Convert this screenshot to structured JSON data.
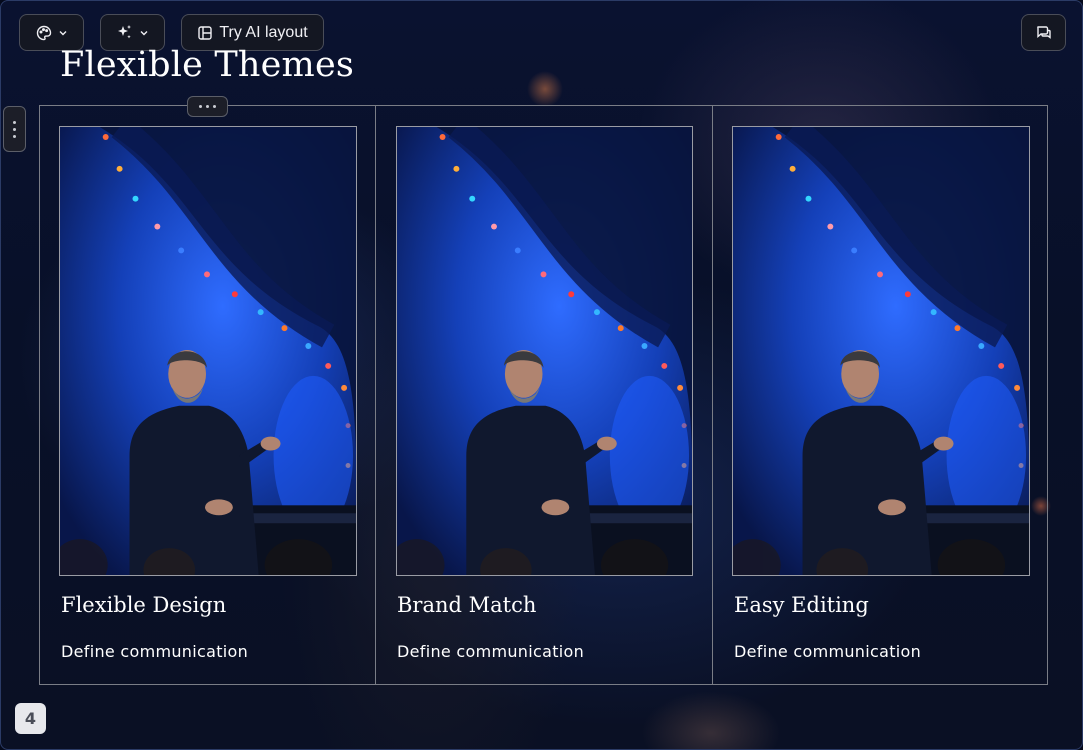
{
  "toolbar": {
    "theme_icon": "palette-icon",
    "magic_icon": "sparkles-icon",
    "layout_icon": "layout-icon",
    "layout_label": "Try AI layout",
    "chat_icon": "comment-icon"
  },
  "slide": {
    "title": "Flexible Themes",
    "cards": [
      {
        "title": "Flexible Design",
        "description": "Define communication"
      },
      {
        "title": "Brand Match",
        "description": "Define communication"
      },
      {
        "title": "Easy Editing",
        "description": "Define communication"
      }
    ],
    "page_number": "4"
  },
  "colors": {
    "background": "#050a1c",
    "card_border": "#7a7d86",
    "text": "#ffffff"
  }
}
